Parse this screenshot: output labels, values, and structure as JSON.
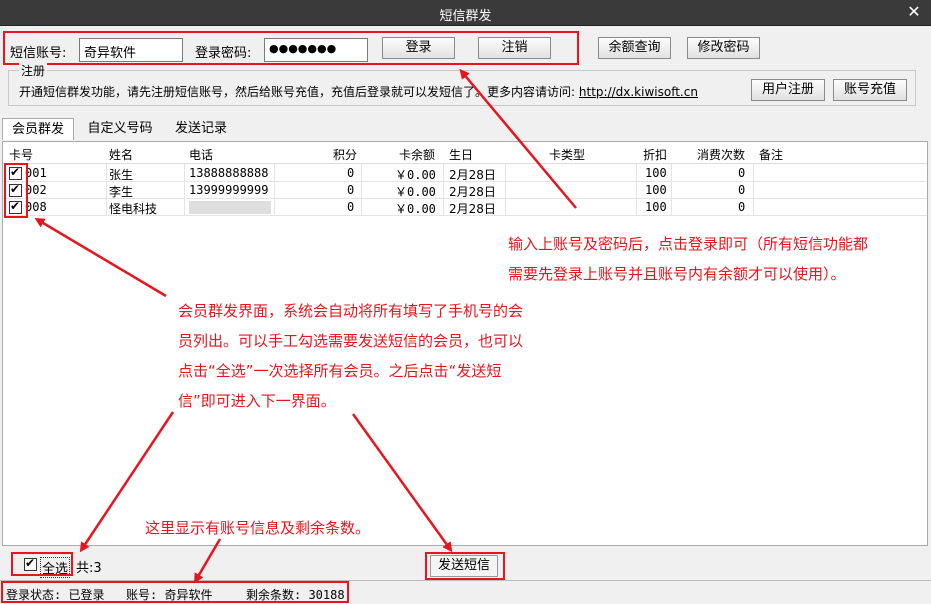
{
  "window": {
    "title": "短信群发"
  },
  "login": {
    "account_label": "短信账号:",
    "account_value": "奇异软件",
    "password_label": "登录密码:",
    "password_value": "●●●●●●●",
    "login_button": "登录",
    "logout_button": "注销",
    "balance_button": "余额查询",
    "change_password_button": "修改密码"
  },
  "register": {
    "legend": "注册",
    "text": "开通短信群发功能，请先注册短信账号，然后给账号充值，充值后登录就可以发短信了。更多内容请访问:",
    "link": "http://dx.kiwisoft.cn",
    "register_button": "用户注册",
    "recharge_button": "账号充值"
  },
  "tabs": [
    "会员群发",
    "自定义号码",
    "发送记录"
  ],
  "table": {
    "headers": [
      "卡号",
      "姓名",
      "电话",
      "积分",
      "卡余额",
      "生日",
      "卡类型",
      "折扣",
      "消费次数",
      "备注"
    ],
    "rows": [
      {
        "checked": true,
        "card": "001",
        "name": "张生",
        "phone": "13888888888",
        "points": "0",
        "balance": "￥0.00",
        "birthday": "2月28日",
        "card_type": "",
        "discount": "100",
        "count": "0",
        "note": ""
      },
      {
        "checked": true,
        "card": "002",
        "name": "李生",
        "phone": "13999999999",
        "points": "0",
        "balance": "￥0.00",
        "birthday": "2月28日",
        "card_type": "",
        "discount": "100",
        "count": "0",
        "note": ""
      },
      {
        "checked": true,
        "card": "008",
        "name": "怪电科技",
        "phone": "",
        "points": "0",
        "balance": "￥0.00",
        "birthday": "2月28日",
        "card_type": "",
        "discount": "100",
        "count": "0",
        "note": ""
      }
    ]
  },
  "footer": {
    "select_all": "全选",
    "total": "共:3",
    "send_button": "发送短信"
  },
  "status": {
    "login_status": "登录状态: 已登录",
    "account": "账号: 奇异软件",
    "remaining": "剩余条数: 30188"
  },
  "annotations": {
    "login_note": [
      "输入上账号及密码后，点击登录即可（所有短信功能都",
      "需要先登录上账号并且账号内有余额才可以使用）。"
    ],
    "member_note": [
      "会员群发界面，系统会自动将所有填写了手机号的会",
      "员列出。可以手工勾选需要发送短信的会员，也可以",
      "点击“全选”一次选择所有会员。之后点击“发送短",
      "信”即可进入下一界面。"
    ],
    "status_note": "这里显示有账号信息及剩余条数。"
  },
  "colors": {
    "annotation": "#e8141e",
    "titlebar": "#3a3a3a"
  }
}
